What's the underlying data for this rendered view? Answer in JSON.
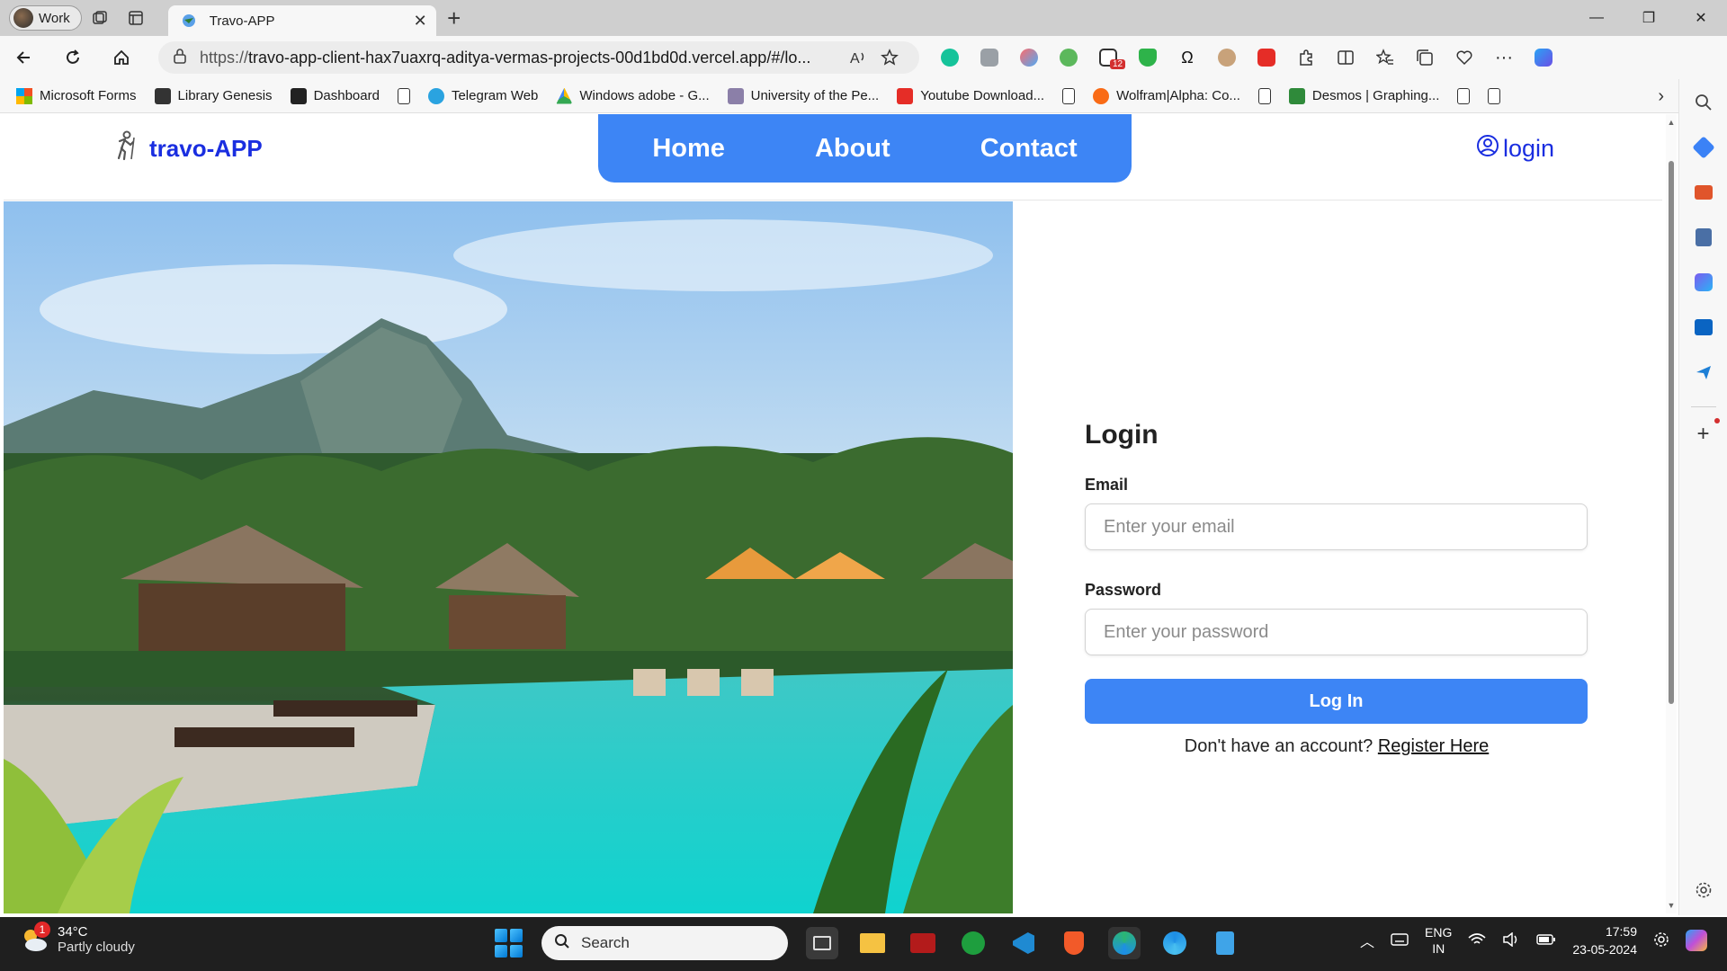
{
  "browser": {
    "profile_label": "Work",
    "tab_title": "Travo-APP",
    "url_prefix": "https://",
    "url_host": "travo-app-client-hax7uaxrq-aditya-vermas-projects-00d1bd0d.vercel.app/#/lo...",
    "ext_badge": "12"
  },
  "bookmarks": [
    {
      "label": "Microsoft Forms",
      "color": "#f25022"
    },
    {
      "label": "Library Genesis",
      "color": "#333333"
    },
    {
      "label": "Dashboard",
      "color": "#222222"
    },
    {
      "label": "",
      "color": "#ffffff"
    },
    {
      "label": "Telegram Web",
      "color": "#2aa3e0"
    },
    {
      "label": "Windows adobe - G...",
      "color": "#fbbc04"
    },
    {
      "label": "University of the Pe...",
      "color": "#8b7fa8"
    },
    {
      "label": "Youtube Download...",
      "color": "#e52d27"
    },
    {
      "label": "",
      "color": "#ffffff"
    },
    {
      "label": "Wolfram|Alpha: Co...",
      "color": "#f96b16"
    },
    {
      "label": "",
      "color": "#ffffff"
    },
    {
      "label": "Desmos | Graphing...",
      "color": "#2f8a3a"
    },
    {
      "label": "",
      "color": "#ffffff"
    },
    {
      "label": "",
      "color": "#ffffff"
    }
  ],
  "site": {
    "logo_text": "travo-APP",
    "nav": {
      "home": "Home",
      "about": "About",
      "contact": "Contact"
    },
    "login_link": "login",
    "accent_color": "#3d85f5",
    "brand_color": "#1a2ee0"
  },
  "login_form": {
    "title": "Login",
    "email_label": "Email",
    "email_placeholder": "Enter your email",
    "password_label": "Password",
    "password_placeholder": "Enter your password",
    "submit_label": "Log In",
    "register_prompt": "Don't have an account?",
    "register_link": "Register Here"
  },
  "taskbar": {
    "weather_temp": "34°C",
    "weather_cond": "Partly cloudy",
    "weather_badge": "1",
    "search_label": "Search",
    "lang_line1": "ENG",
    "lang_line2": "IN",
    "time": "17:59",
    "date": "23-05-2024"
  }
}
